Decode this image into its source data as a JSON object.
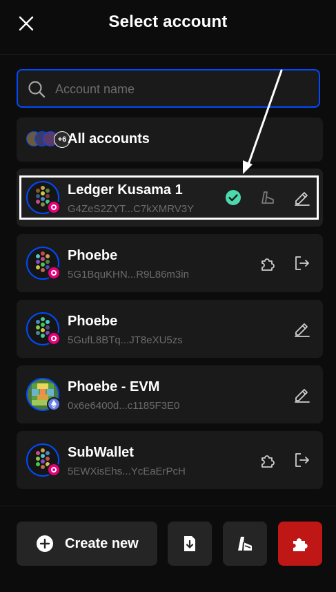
{
  "header": {
    "title": "Select account"
  },
  "search": {
    "placeholder": "Account name"
  },
  "all_accounts": {
    "label": "All accounts",
    "extra_count": "+6"
  },
  "accounts": [
    {
      "name": "Ledger Kusama 1",
      "address": "G4ZeS2ZYT...C7kXMRV3Y",
      "network": "polkadot",
      "actions": [
        "check-icon",
        "ledger-icon",
        "edit-icon"
      ],
      "selected": true
    },
    {
      "name": "Phoebe",
      "address": "5G1BquKHN...R9L86m3in",
      "network": "polkadot",
      "actions": [
        "puzzle-icon",
        "export-icon"
      ]
    },
    {
      "name": "Phoebe",
      "address": "5GufL8BTq...JT8eXU5zs",
      "network": "polkadot",
      "actions": [
        "edit-icon"
      ]
    },
    {
      "name": "Phoebe - EVM",
      "address": "0x6e6400d...c1185F3E0",
      "network": "ethereum",
      "actions": [
        "edit-icon"
      ]
    },
    {
      "name": "SubWallet",
      "address": "5EWXisEhs...YcEaErPcH",
      "network": "polkadot",
      "actions": [
        "puzzle-icon",
        "export-icon"
      ]
    }
  ],
  "footer": {
    "create_label": "Create new"
  },
  "colors": {
    "accent": "#004bff",
    "success": "#4cd9ac",
    "danger": "#bf1616",
    "background": "#0c0c0c",
    "card": "#1a1a1a"
  }
}
